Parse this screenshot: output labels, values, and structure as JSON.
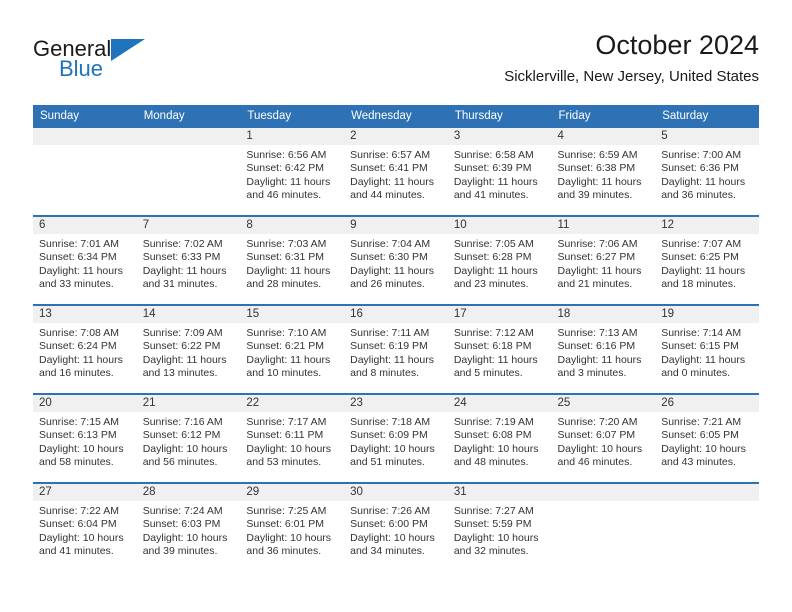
{
  "brand": {
    "name_part1": "General",
    "name_part2": "Blue",
    "logo_icon": "triangle-logo-icon"
  },
  "header": {
    "title": "October 2024",
    "subtitle": "Sicklerville, New Jersey, United States"
  },
  "colors": {
    "header_blue": "#2e72b5",
    "brand_blue": "#1f74bd",
    "day_band_gray": "#f0f0f0",
    "text": "#333333"
  },
  "weekdays": [
    "Sunday",
    "Monday",
    "Tuesday",
    "Wednesday",
    "Thursday",
    "Friday",
    "Saturday"
  ],
  "weeks": [
    [
      {
        "day": "",
        "sunrise": "",
        "sunset": "",
        "daylight": ""
      },
      {
        "day": "",
        "sunrise": "",
        "sunset": "",
        "daylight": ""
      },
      {
        "day": "1",
        "sunrise": "Sunrise: 6:56 AM",
        "sunset": "Sunset: 6:42 PM",
        "daylight": "Daylight: 11 hours and 46 minutes."
      },
      {
        "day": "2",
        "sunrise": "Sunrise: 6:57 AM",
        "sunset": "Sunset: 6:41 PM",
        "daylight": "Daylight: 11 hours and 44 minutes."
      },
      {
        "day": "3",
        "sunrise": "Sunrise: 6:58 AM",
        "sunset": "Sunset: 6:39 PM",
        "daylight": "Daylight: 11 hours and 41 minutes."
      },
      {
        "day": "4",
        "sunrise": "Sunrise: 6:59 AM",
        "sunset": "Sunset: 6:38 PM",
        "daylight": "Daylight: 11 hours and 39 minutes."
      },
      {
        "day": "5",
        "sunrise": "Sunrise: 7:00 AM",
        "sunset": "Sunset: 6:36 PM",
        "daylight": "Daylight: 11 hours and 36 minutes."
      }
    ],
    [
      {
        "day": "6",
        "sunrise": "Sunrise: 7:01 AM",
        "sunset": "Sunset: 6:34 PM",
        "daylight": "Daylight: 11 hours and 33 minutes."
      },
      {
        "day": "7",
        "sunrise": "Sunrise: 7:02 AM",
        "sunset": "Sunset: 6:33 PM",
        "daylight": "Daylight: 11 hours and 31 minutes."
      },
      {
        "day": "8",
        "sunrise": "Sunrise: 7:03 AM",
        "sunset": "Sunset: 6:31 PM",
        "daylight": "Daylight: 11 hours and 28 minutes."
      },
      {
        "day": "9",
        "sunrise": "Sunrise: 7:04 AM",
        "sunset": "Sunset: 6:30 PM",
        "daylight": "Daylight: 11 hours and 26 minutes."
      },
      {
        "day": "10",
        "sunrise": "Sunrise: 7:05 AM",
        "sunset": "Sunset: 6:28 PM",
        "daylight": "Daylight: 11 hours and 23 minutes."
      },
      {
        "day": "11",
        "sunrise": "Sunrise: 7:06 AM",
        "sunset": "Sunset: 6:27 PM",
        "daylight": "Daylight: 11 hours and 21 minutes."
      },
      {
        "day": "12",
        "sunrise": "Sunrise: 7:07 AM",
        "sunset": "Sunset: 6:25 PM",
        "daylight": "Daylight: 11 hours and 18 minutes."
      }
    ],
    [
      {
        "day": "13",
        "sunrise": "Sunrise: 7:08 AM",
        "sunset": "Sunset: 6:24 PM",
        "daylight": "Daylight: 11 hours and 16 minutes."
      },
      {
        "day": "14",
        "sunrise": "Sunrise: 7:09 AM",
        "sunset": "Sunset: 6:22 PM",
        "daylight": "Daylight: 11 hours and 13 minutes."
      },
      {
        "day": "15",
        "sunrise": "Sunrise: 7:10 AM",
        "sunset": "Sunset: 6:21 PM",
        "daylight": "Daylight: 11 hours and 10 minutes."
      },
      {
        "day": "16",
        "sunrise": "Sunrise: 7:11 AM",
        "sunset": "Sunset: 6:19 PM",
        "daylight": "Daylight: 11 hours and 8 minutes."
      },
      {
        "day": "17",
        "sunrise": "Sunrise: 7:12 AM",
        "sunset": "Sunset: 6:18 PM",
        "daylight": "Daylight: 11 hours and 5 minutes."
      },
      {
        "day": "18",
        "sunrise": "Sunrise: 7:13 AM",
        "sunset": "Sunset: 6:16 PM",
        "daylight": "Daylight: 11 hours and 3 minutes."
      },
      {
        "day": "19",
        "sunrise": "Sunrise: 7:14 AM",
        "sunset": "Sunset: 6:15 PM",
        "daylight": "Daylight: 11 hours and 0 minutes."
      }
    ],
    [
      {
        "day": "20",
        "sunrise": "Sunrise: 7:15 AM",
        "sunset": "Sunset: 6:13 PM",
        "daylight": "Daylight: 10 hours and 58 minutes."
      },
      {
        "day": "21",
        "sunrise": "Sunrise: 7:16 AM",
        "sunset": "Sunset: 6:12 PM",
        "daylight": "Daylight: 10 hours and 56 minutes."
      },
      {
        "day": "22",
        "sunrise": "Sunrise: 7:17 AM",
        "sunset": "Sunset: 6:11 PM",
        "daylight": "Daylight: 10 hours and 53 minutes."
      },
      {
        "day": "23",
        "sunrise": "Sunrise: 7:18 AM",
        "sunset": "Sunset: 6:09 PM",
        "daylight": "Daylight: 10 hours and 51 minutes."
      },
      {
        "day": "24",
        "sunrise": "Sunrise: 7:19 AM",
        "sunset": "Sunset: 6:08 PM",
        "daylight": "Daylight: 10 hours and 48 minutes."
      },
      {
        "day": "25",
        "sunrise": "Sunrise: 7:20 AM",
        "sunset": "Sunset: 6:07 PM",
        "daylight": "Daylight: 10 hours and 46 minutes."
      },
      {
        "day": "26",
        "sunrise": "Sunrise: 7:21 AM",
        "sunset": "Sunset: 6:05 PM",
        "daylight": "Daylight: 10 hours and 43 minutes."
      }
    ],
    [
      {
        "day": "27",
        "sunrise": "Sunrise: 7:22 AM",
        "sunset": "Sunset: 6:04 PM",
        "daylight": "Daylight: 10 hours and 41 minutes."
      },
      {
        "day": "28",
        "sunrise": "Sunrise: 7:24 AM",
        "sunset": "Sunset: 6:03 PM",
        "daylight": "Daylight: 10 hours and 39 minutes."
      },
      {
        "day": "29",
        "sunrise": "Sunrise: 7:25 AM",
        "sunset": "Sunset: 6:01 PM",
        "daylight": "Daylight: 10 hours and 36 minutes."
      },
      {
        "day": "30",
        "sunrise": "Sunrise: 7:26 AM",
        "sunset": "Sunset: 6:00 PM",
        "daylight": "Daylight: 10 hours and 34 minutes."
      },
      {
        "day": "31",
        "sunrise": "Sunrise: 7:27 AM",
        "sunset": "Sunset: 5:59 PM",
        "daylight": "Daylight: 10 hours and 32 minutes."
      },
      {
        "day": "",
        "sunrise": "",
        "sunset": "",
        "daylight": ""
      },
      {
        "day": "",
        "sunrise": "",
        "sunset": "",
        "daylight": ""
      }
    ]
  ]
}
